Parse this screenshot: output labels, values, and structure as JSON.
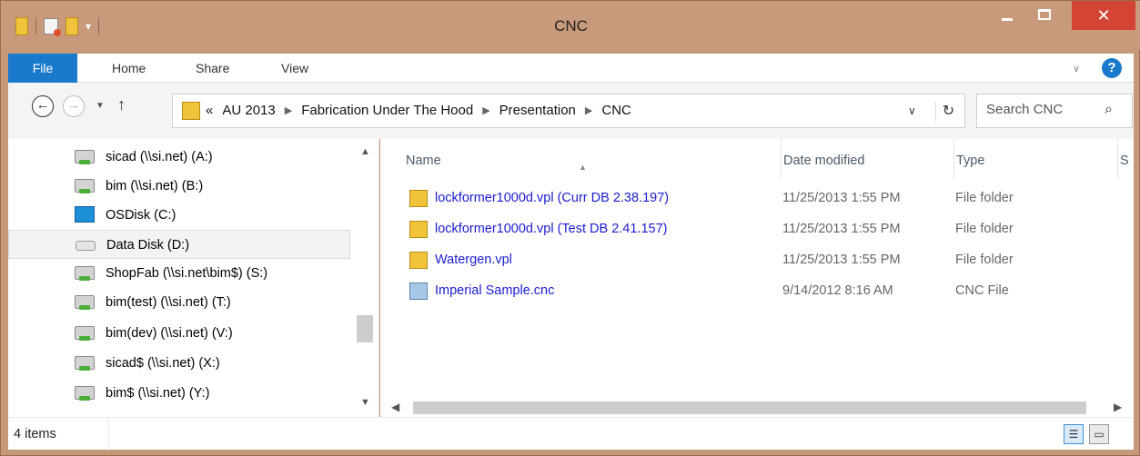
{
  "window": {
    "title": "CNC"
  },
  "title_buttons": {
    "minimize": "–",
    "maximize": "□",
    "close": "✕"
  },
  "ribbon": {
    "tabs": [
      {
        "label": "File",
        "active": true
      },
      {
        "label": "Home"
      },
      {
        "label": "Share"
      },
      {
        "label": "View"
      }
    ],
    "help": "?"
  },
  "nav": {
    "back": "←",
    "forward": "→",
    "up": "↑",
    "breadcrumb": [
      "«",
      "AU 2013",
      "Fabrication Under The Hood",
      "Presentation",
      "CNC"
    ],
    "search_placeholder": "Search CNC"
  },
  "sidebar": {
    "items": [
      {
        "label": "sicad (\\\\si.net) (A:)",
        "icon": "network-drive-icon"
      },
      {
        "label": "bim (\\\\si.net) (B:)",
        "icon": "network-drive-icon"
      },
      {
        "label": "OSDisk (C:)",
        "icon": "os-drive-icon"
      },
      {
        "label": "Data Disk (D:)",
        "icon": "hard-drive-icon",
        "selected": true
      },
      {
        "label": "ShopFab (\\\\si.net\\bim$) (S:)",
        "icon": "network-drive-icon"
      },
      {
        "label": "bim(test) (\\\\si.net) (T:)",
        "icon": "network-drive-icon"
      },
      {
        "label": "bim(dev) (\\\\si.net) (V:)",
        "icon": "network-drive-icon"
      },
      {
        "label": "sicad$ (\\\\si.net) (X:)",
        "icon": "network-drive-icon"
      },
      {
        "label": "bim$ (\\\\si.net) (Y:)",
        "icon": "network-drive-icon"
      }
    ]
  },
  "filelist": {
    "columns": [
      "Name",
      "Date modified",
      "Type",
      "S"
    ],
    "rows": [
      {
        "name": "lockformer1000d.vpl (Curr DB 2.38.197)",
        "date": "11/25/2013 1:55 PM",
        "type": "File folder",
        "icon": "folder-icon"
      },
      {
        "name": "lockformer1000d.vpl (Test DB 2.41.157)",
        "date": "11/25/2013 1:55 PM",
        "type": "File folder",
        "icon": "folder-icon"
      },
      {
        "name": "Watergen.vpl",
        "date": "11/25/2013 1:55 PM",
        "type": "File folder",
        "icon": "folder-icon"
      },
      {
        "name": "Imperial Sample.cnc",
        "date": "9/14/2012 8:16 AM",
        "type": "CNC File",
        "icon": "cnc-file-icon"
      }
    ]
  },
  "status": {
    "count": "4 items"
  }
}
